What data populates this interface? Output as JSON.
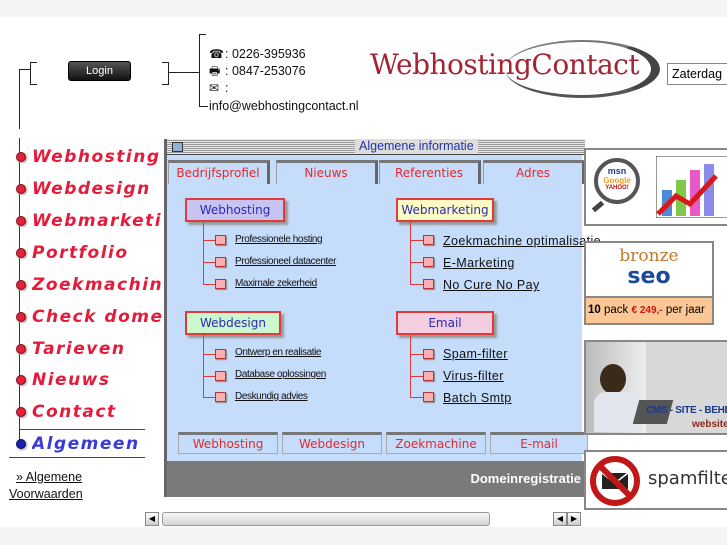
{
  "header": {
    "login_label": "Login",
    "phone_icon": "☎",
    "phone": ": 0226-395936",
    "fax_icon": "🖶",
    "fax": ": 0847-253076",
    "mail_icon": "✉",
    "mail_colon": ":",
    "email": "info@webhostingcontact.nl",
    "logo_text": "WebhostingContact",
    "date_value": "Zaterdag"
  },
  "nav": {
    "items": [
      {
        "label": "Webhosting"
      },
      {
        "label": "Webdesign"
      },
      {
        "label": "Webmarketing"
      },
      {
        "label": "Portfolio"
      },
      {
        "label": "Zoekmachine"
      },
      {
        "label": "Check domein"
      },
      {
        "label": "Tarieven"
      },
      {
        "label": "Nieuws"
      },
      {
        "label": "Contact"
      },
      {
        "label": "Algemeen"
      }
    ],
    "active": "Algemeen",
    "sublink_1": "» Algemene",
    "sublink_2": "Voorwaarden"
  },
  "panel": {
    "title": "Algemene informatie",
    "tabs_top": [
      "Bedrijfsprofiel",
      "Nieuws",
      "Referenties",
      "Adres"
    ],
    "categories": {
      "webhosting": {
        "label": "Webhosting",
        "items": [
          "Professionele hosting",
          "Professioneel datacenter",
          "Maximale zekerheid"
        ]
      },
      "webdesign": {
        "label": "Webdesign",
        "items": [
          "Ontwerp en realisatie",
          "Database oplossingen",
          "Deskundig advies"
        ]
      },
      "webmarketing": {
        "label": "Webmarketing",
        "items": [
          "Zoekmachine optimalisatie",
          "E-Marketing",
          "No Cure No Pay"
        ]
      },
      "email": {
        "label": "Email",
        "items": [
          "Spam-filter",
          "Virus-filter",
          "Batch Smtp"
        ]
      }
    },
    "tabs_bottom": [
      "Webhosting",
      "Webdesign",
      "Zoekmachine",
      "E-mail"
    ],
    "footer": "Domeinregistratie"
  },
  "ads": {
    "seo_search": {
      "msn": "msn",
      "google": "Google",
      "yahoo": "YAHOO!"
    },
    "bronze": {
      "top": "bronze",
      "bottom": "seo",
      "pack": "10",
      "pack_word": "pack",
      "price": "€ 249,-",
      "per": "per jaar"
    },
    "cms": {
      "line1": "CMS - SITE - BEHEER",
      "line2": "websites"
    },
    "spam": {
      "label": "spamfilter"
    }
  },
  "colors": {
    "nav_red": "#e41c3c",
    "nav_active": "#3a3ad8",
    "panel_bg": "#c5dcfb",
    "logo": "#a32434"
  }
}
